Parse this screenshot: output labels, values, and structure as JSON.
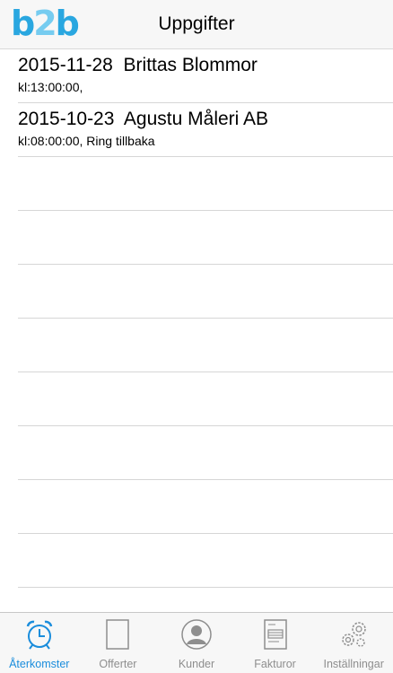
{
  "header": {
    "logo_text": "b2b",
    "title": "Uppgifter"
  },
  "tasks": [
    {
      "title": "2015-11-28  Brittas Blommor",
      "subtitle": "kl:13:00:00,"
    },
    {
      "title": "2015-10-23  Agustu Måleri AB",
      "subtitle": "kl:08:00:00, Ring tillbaka"
    }
  ],
  "tabs": [
    {
      "label": "Återkomster",
      "icon": "alarm-clock-icon",
      "active": true
    },
    {
      "label": "Offerter",
      "icon": "document-icon",
      "active": false
    },
    {
      "label": "Kunder",
      "icon": "person-icon",
      "active": false
    },
    {
      "label": "Fakturor",
      "icon": "invoice-icon",
      "active": false
    },
    {
      "label": "Inställningar",
      "icon": "gears-icon",
      "active": false
    }
  ],
  "colors": {
    "accent": "#1a8ddc",
    "inactive": "#8e8e8e",
    "logo": "#2aa7e0"
  }
}
